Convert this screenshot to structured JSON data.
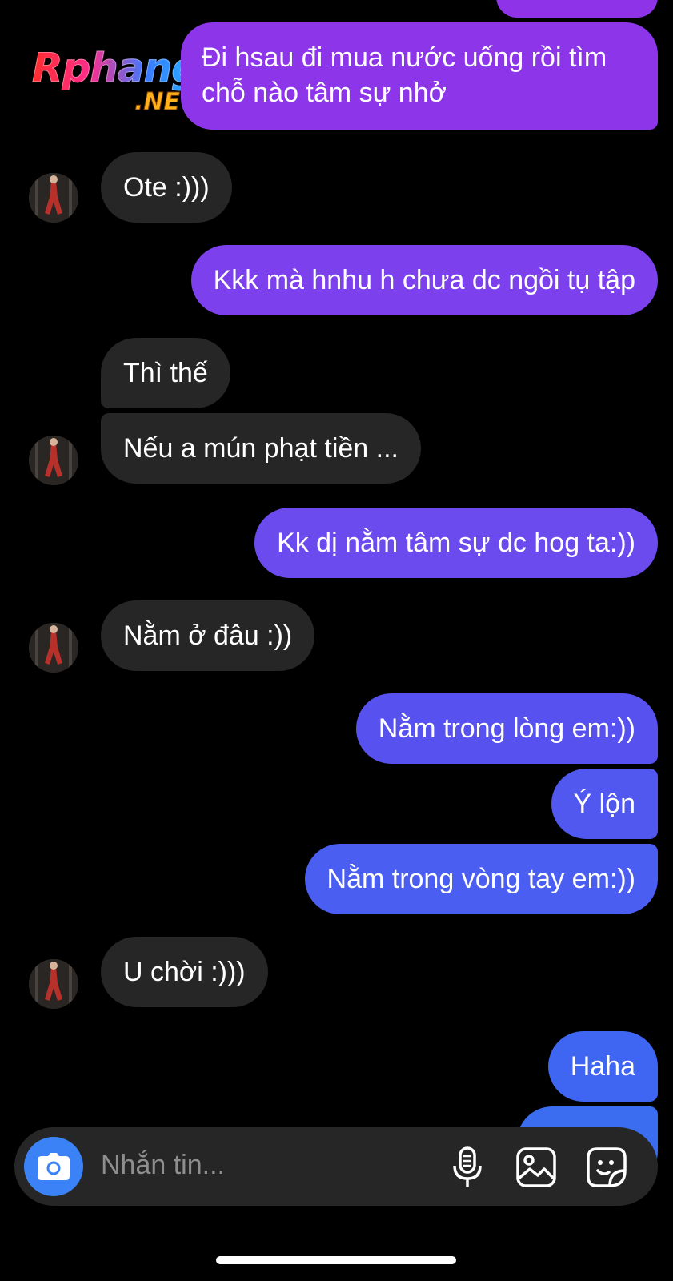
{
  "watermark": {
    "main": "Rphangs",
    "sub": ".NET"
  },
  "messages": {
    "m1": "Đi hsau đi mua nước uống rồi tìm chỗ nào tâm sự nhở",
    "m2": "Ote :)))",
    "m3": "Kkk mà hnhu h chưa dc ngồi tụ tập",
    "m4": "Thì thế",
    "m5": "Nếu a mún phạt tiền ...",
    "m6": "Kk dị nằm tâm sự dc hog ta:))",
    "m7": "Nằm ở đâu :))",
    "m8": "Nằm trong lòng em:))",
    "m9": "Ý lộn",
    "m10": "Nằm trong vòng tay em:))",
    "m11": "U chời :)))",
    "m12": "Haha"
  },
  "composer": {
    "placeholder": "Nhắn tin...",
    "icons": [
      "camera-icon",
      "microphone-icon",
      "gallery-icon",
      "sticker-icon"
    ]
  },
  "colors": {
    "outgoing_top": "#8a3ae6",
    "outgoing_bottom": "#3b6df0",
    "incoming": "#262626",
    "camera_button": "#3b82f6"
  }
}
